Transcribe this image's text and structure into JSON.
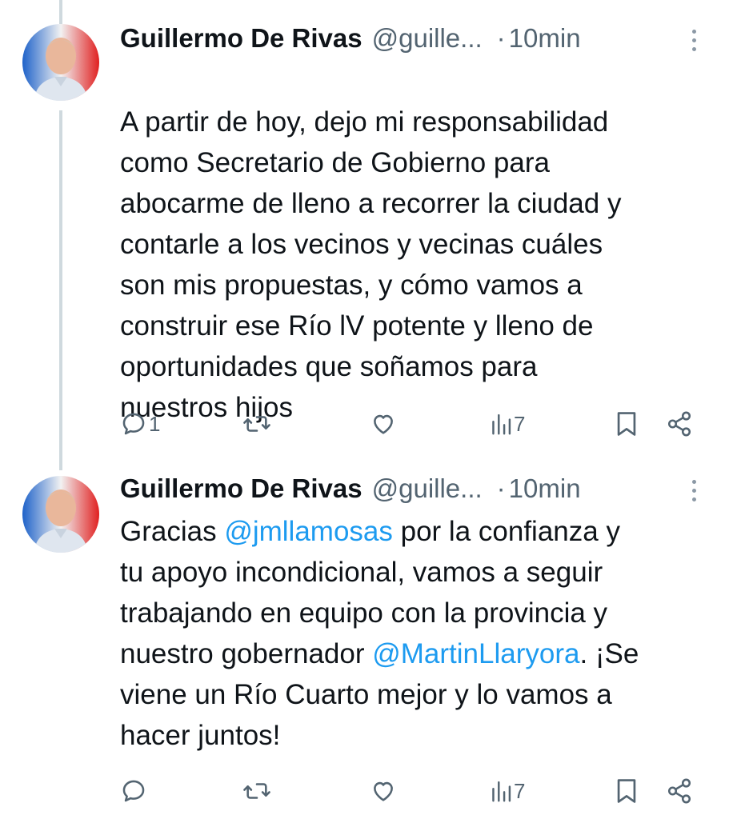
{
  "tweets": [
    {
      "author_name": "Guillermo De Rivas",
      "handle": "@guille...",
      "dot": "·",
      "time": "10min",
      "segments": [
        {
          "text": "A partir de hoy, dejo mi responsabilidad\ncomo Secretario de Gobierno para\nabocarme de lleno a recorrer la ciudad y\ncontarle a los vecinos y vecinas cuáles\nson mis propuestas, y cómo vamos a\nconstruir ese Río lV potente y lleno de\noportunidades que soñamos para\nnuestros hijos"
        }
      ],
      "reply_count": "1",
      "retweet_count": "",
      "like_count": "",
      "views_count": "7"
    },
    {
      "author_name": "Guillermo De Rivas",
      "handle": "@guille...",
      "dot": "·",
      "time": "10min",
      "segments": [
        {
          "text": "Gracias "
        },
        {
          "text": "@jmllamosas"
        },
        {
          "text": " por la confianza y\ntu apoyo incondicional, vamos a seguir\ntrabajando en equipo con la provincia y\nnuestro gobernador "
        },
        {
          "text": "@MartinLlaryora"
        },
        {
          "text": ". ¡Se\nviene un Río Cuarto mejor y lo vamos a\nhacer juntos!"
        }
      ],
      "reply_count": "",
      "retweet_count": "",
      "like_count": "",
      "views_count": "7"
    }
  ],
  "icons": {
    "reply": "reply-icon",
    "retweet": "retweet-icon",
    "like": "heart-icon",
    "views": "views-icon",
    "bookmark": "bookmark-icon",
    "share": "share-icon",
    "more": "more-vertical-icon"
  },
  "colors": {
    "text": "#0f1419",
    "muted": "#536471",
    "link": "#1d9bf0",
    "thread_line": "#cfd9de"
  }
}
